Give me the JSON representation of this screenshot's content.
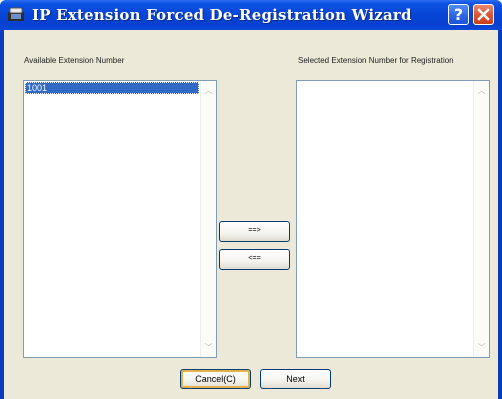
{
  "window": {
    "title": "IP Extension Forced De-Registration Wizard",
    "help_symbol": "?",
    "icons": {
      "app": "phone-app-icon",
      "help": "help-icon",
      "close": "close-icon"
    }
  },
  "available": {
    "label": "Available Extension Number",
    "items": [
      "1001"
    ],
    "selected_item": "1001"
  },
  "selected": {
    "label": "Selected Extension Number for Registration",
    "items": []
  },
  "transfer": {
    "add_label": "==>",
    "remove_label": "<=="
  },
  "footer": {
    "cancel_label": "Cancel(C)",
    "next_label": "Next"
  },
  "colors": {
    "titlebar": "#0846d8",
    "dialog_bg": "#ece9d8",
    "selection": "#316ac5",
    "close_button": "#d9552f"
  }
}
